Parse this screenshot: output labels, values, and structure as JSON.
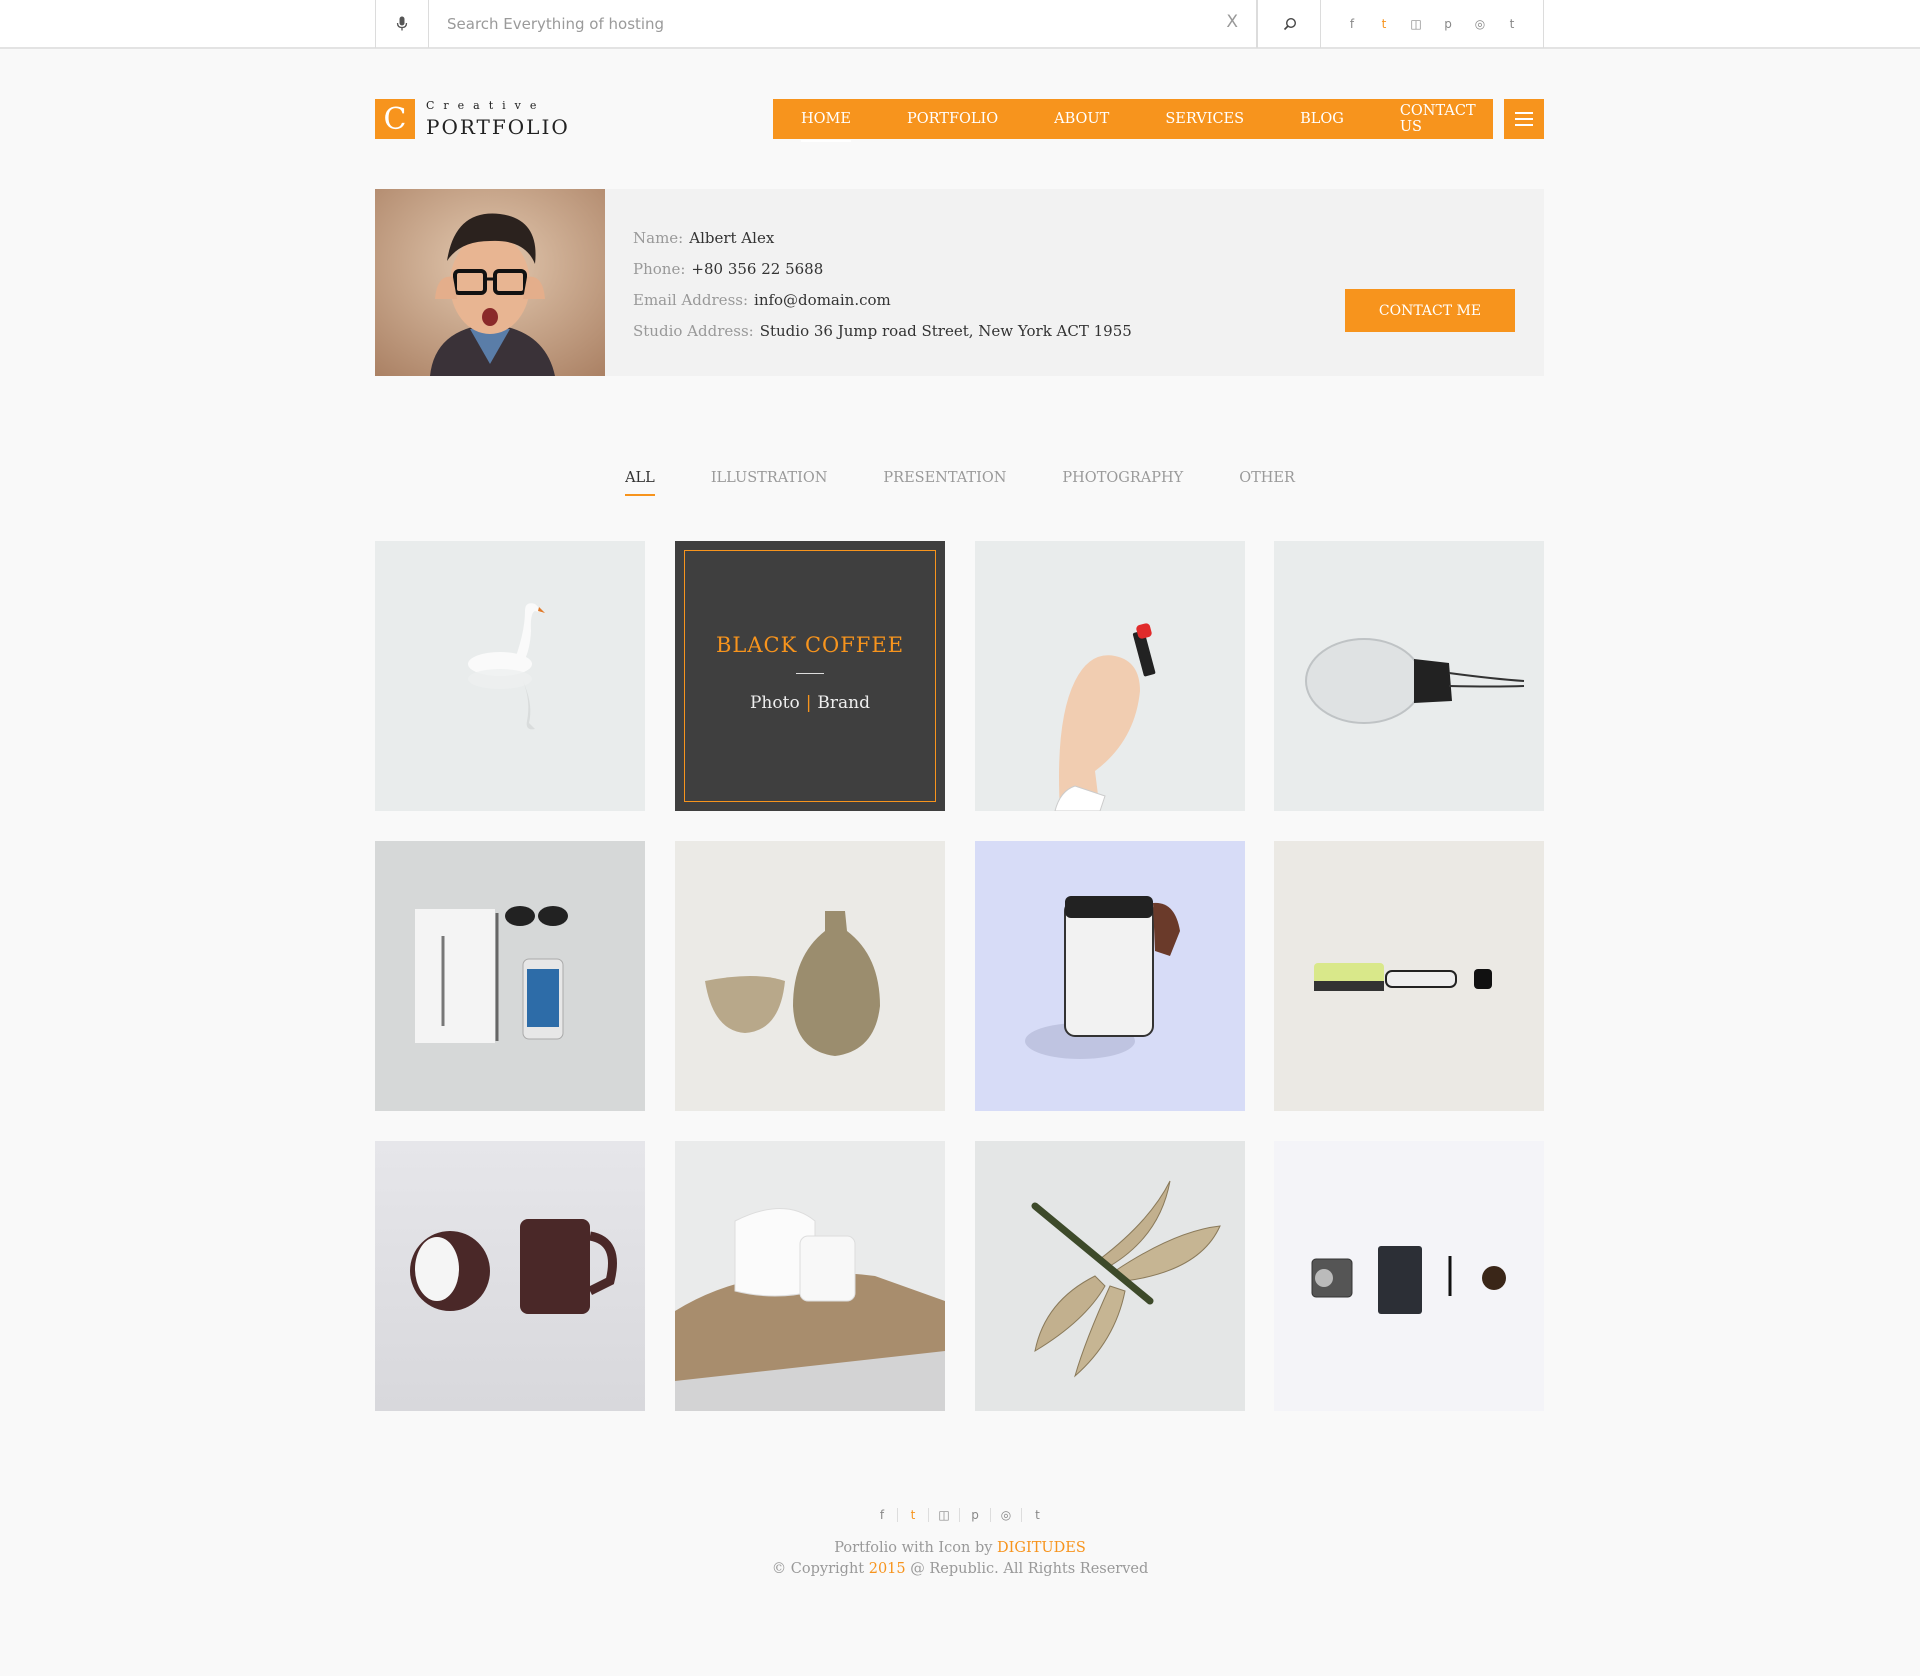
{
  "search": {
    "placeholder": "Search Everything of hosting",
    "clear_label": "X"
  },
  "social": [
    "f",
    "t",
    "◫",
    "p",
    "◎",
    "t"
  ],
  "logo": {
    "letter": "C",
    "top": "Creative",
    "bottom": "PORTFOLIO"
  },
  "nav": {
    "items": [
      "HOME",
      "PORTFOLIO",
      "ABOUT",
      "SERVICES",
      "BLOG",
      "CONTACT US"
    ]
  },
  "profile": {
    "name_label": "Name:",
    "name": "Albert Alex",
    "phone_label": "Phone:",
    "phone": "+80 356 22 5688",
    "email_label": "Email Address:",
    "email": "info@domain.com",
    "address_label": "Studio Address:",
    "address": "Studio 36 Jump road Street, New York ACT 1955",
    "contact_button": "CONTACT ME"
  },
  "filters": [
    "ALL",
    "ILLUSTRATION",
    "PRESENTATION",
    "PHOTOGRAPHY",
    "OTHER"
  ],
  "featured": {
    "title": "BLACK COFFEE",
    "cat1": "Photo",
    "separator": "|",
    "cat2": "Brand"
  },
  "footer": {
    "line1_prefix": "Portfolio with Icon by ",
    "line1_brand": "DIGITUDES",
    "line2_prefix": "© Copyright ",
    "line2_year": "2015",
    "line2_suffix": " @ Republic. All Rights Reserved"
  },
  "colors": {
    "accent": "#f7941d",
    "dark_tile": "#3f3f3f"
  }
}
